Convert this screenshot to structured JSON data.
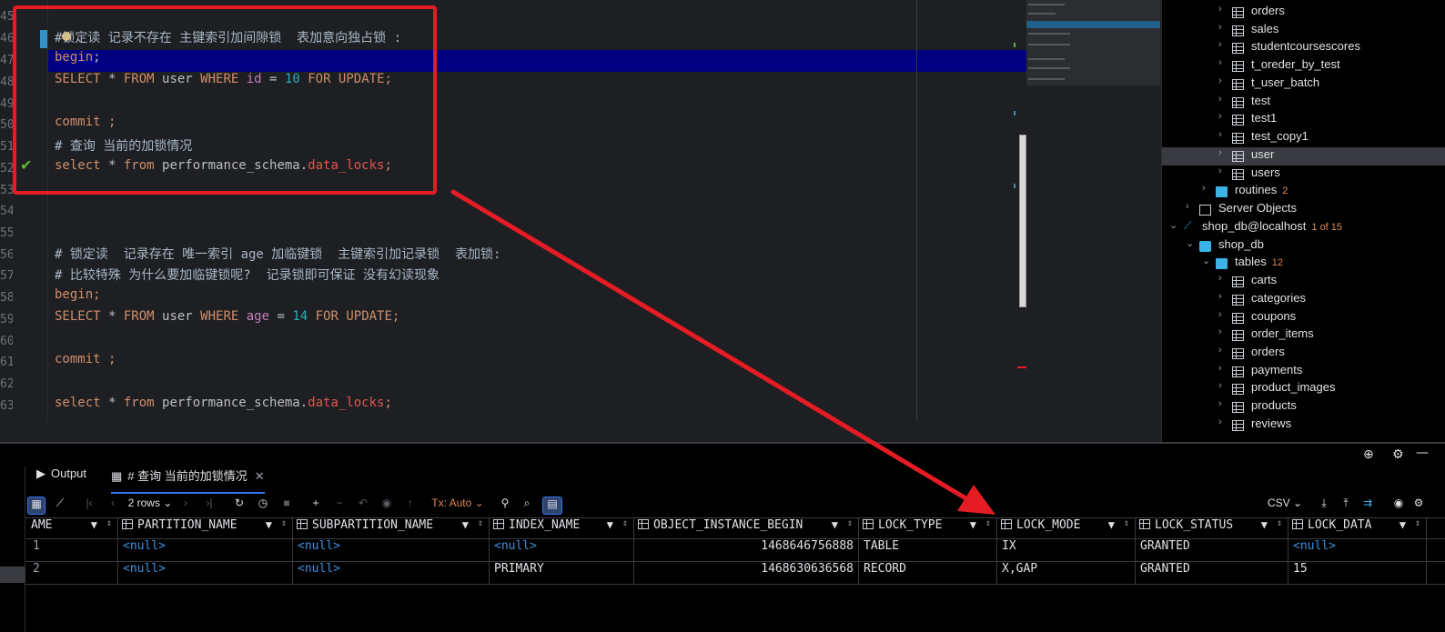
{
  "editor": {
    "line_numbers": [
      "45",
      "46",
      "47",
      "48",
      "49",
      "50",
      "51",
      "52",
      "53",
      "54",
      "55",
      "56",
      "57",
      "58",
      "59",
      "60",
      "61",
      "62",
      "63"
    ],
    "lines": [
      {
        "comment": "#锁定读 记录不存在 主键索引加间隙锁  表加意向独占锁 :"
      },
      {
        "kw": "begin",
        "rest": ";"
      },
      {
        "sel_select": "SELECT",
        "star": " * ",
        "from": "FROM",
        "table": " user ",
        "where": "WHERE",
        "col": " id",
        "eq": " = ",
        "num": "10",
        "tail": " FOR UPDATE",
        "semi": ";"
      },
      {
        "kw": "commit",
        "rest": " ;"
      },
      {
        "comment": "# 查询 当前的加锁情况"
      },
      {
        "kw": "select",
        "star": " * ",
        "from": "from",
        "ident": " performance_schema.",
        "red": "data_locks",
        "semi": ";"
      },
      {
        "comment": "# 锁定读  记录存在 唯一索引 age 加临键锁  主键索引加记录锁  表加锁:"
      },
      {
        "comment": "# 比较特殊 为什么要加临键锁呢?  记录锁即可保证 没有幻读现象"
      },
      {
        "kw": "begin",
        "rest": ";"
      },
      {
        "sel_select": "SELECT",
        "star": " * ",
        "from": "FROM",
        "table": " user ",
        "where": "WHERE",
        "col": " age",
        "eq": " = ",
        "num": "14",
        "tail": " FOR UPDATE",
        "semi": ";"
      },
      {
        "kw": "commit",
        "rest": " ;"
      },
      {
        "kw": "select",
        "star": " * ",
        "from": "from",
        "ident": " performance_schema.",
        "red": "data_locks",
        "semi": ";"
      }
    ]
  },
  "tree": {
    "items": [
      {
        "label": "orders",
        "type": "table"
      },
      {
        "label": "sales",
        "type": "table"
      },
      {
        "label": "studentcoursescores",
        "type": "table"
      },
      {
        "label": "t_oreder_by_test",
        "type": "table"
      },
      {
        "label": "t_user_batch",
        "type": "table"
      },
      {
        "label": "test",
        "type": "table"
      },
      {
        "label": "test1",
        "type": "table"
      },
      {
        "label": "test_copy1",
        "type": "table"
      },
      {
        "label": "user",
        "type": "table"
      },
      {
        "label": "users",
        "type": "table"
      },
      {
        "label": "routines",
        "count": "2",
        "type": "folder"
      },
      {
        "label": "Server Objects",
        "type": "server"
      },
      {
        "label": "shop_db@localhost",
        "count": "1 of 15",
        "type": "conn"
      },
      {
        "label": "shop_db",
        "type": "db"
      },
      {
        "label": "tables",
        "count": "12",
        "type": "folder"
      },
      {
        "label": "carts",
        "type": "table"
      },
      {
        "label": "categories",
        "type": "table"
      },
      {
        "label": "coupons",
        "type": "table"
      },
      {
        "label": "order_items",
        "type": "table"
      },
      {
        "label": "orders",
        "type": "table"
      },
      {
        "label": "payments",
        "type": "table"
      },
      {
        "label": "product_images",
        "type": "table"
      },
      {
        "label": "products",
        "type": "table"
      },
      {
        "label": "reviews",
        "type": "table"
      }
    ]
  },
  "services": {
    "tabs": [
      {
        "label": "Output",
        "icon": "output-icon"
      },
      {
        "label": "# 查询 当前的加锁情况",
        "icon": "table-icon"
      }
    ]
  },
  "toolbar": {
    "rows_label": "2 rows",
    "tx_label": "Tx: Auto",
    "export_label": "CSV"
  },
  "grid": {
    "columns": [
      "AME",
      "PARTITION_NAME",
      "SUBPARTITION_NAME",
      "INDEX_NAME",
      "OBJECT_INSTANCE_BEGIN",
      "LOCK_TYPE",
      "LOCK_MODE",
      "LOCK_STATUS",
      "LOCK_DATA"
    ],
    "rows": [
      {
        "num": "1",
        "cells": [
          "",
          "<null>",
          "<null>",
          "<null>",
          "1468646756888",
          "TABLE",
          "IX",
          "GRANTED",
          "<null>"
        ]
      },
      {
        "num": "2",
        "cells": [
          "",
          "<null>",
          "<null>",
          "PRIMARY",
          "1468630636568",
          "RECORD",
          "X,GAP",
          "GRANTED",
          "15"
        ]
      }
    ]
  },
  "colors": {
    "accent": "#3574f0",
    "annotation": "#e51c23",
    "null_value": "#3c8fe0",
    "keyword": "#cf8e6d"
  }
}
